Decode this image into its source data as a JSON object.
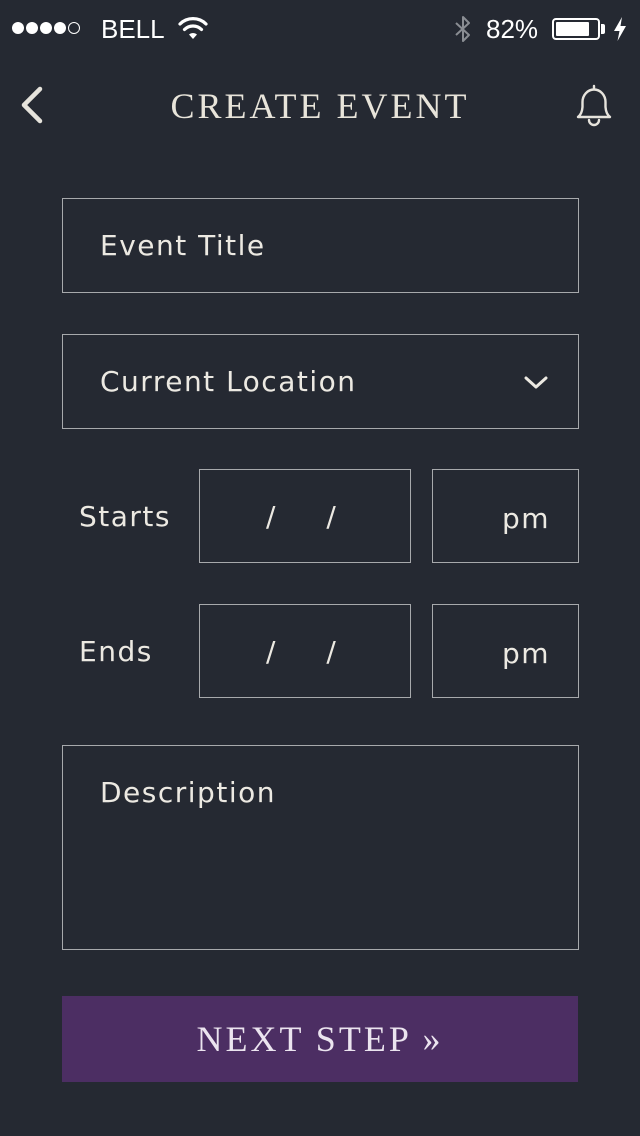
{
  "status_bar": {
    "carrier": "BELL",
    "battery_percent": "82%",
    "battery_level": 0.82,
    "signal_bars_filled": 4,
    "signal_bars_total": 5
  },
  "nav": {
    "title": "CREATE EVENT",
    "back_icon": "chevron-left-icon",
    "notifications_icon": "bell-icon"
  },
  "form": {
    "title_placeholder": "Event Title",
    "location_value": "Current Location",
    "starts": {
      "label": "Starts",
      "date_placeholder": "/ /",
      "time_placeholder": "pm"
    },
    "ends": {
      "label": "Ends",
      "date_placeholder": "/ /",
      "time_placeholder": "pm"
    },
    "description_placeholder": "Description"
  },
  "actions": {
    "next_label": "NEXT STEP »"
  },
  "colors": {
    "background": "#252932",
    "field_border": "#a7a9ac",
    "accent": "#4c2e63",
    "text": "#ece9e2"
  }
}
